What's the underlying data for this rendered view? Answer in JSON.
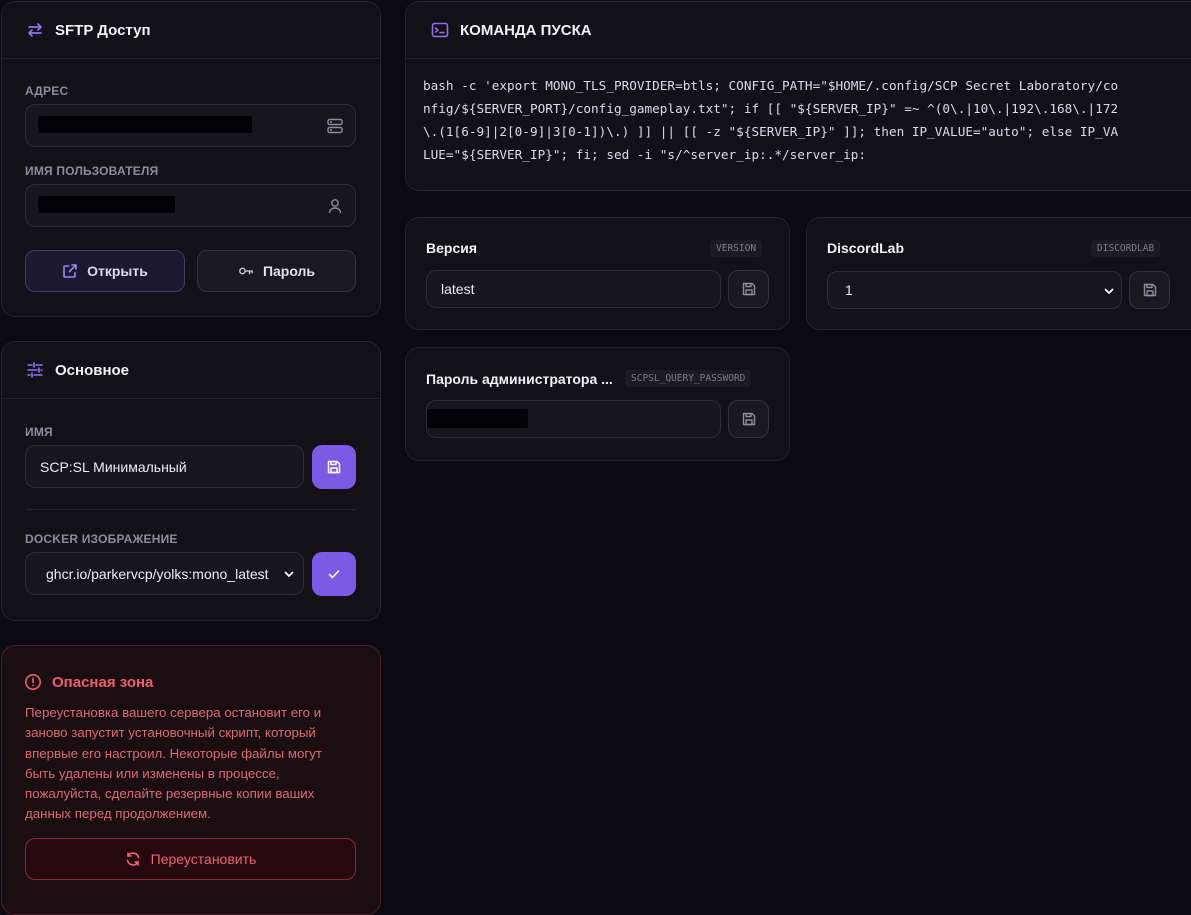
{
  "sftp": {
    "title": "SFTP Доступ",
    "address_label": "АДРЕС",
    "username_label": "ИМЯ ПОЛЬЗОВАТЕЛЯ",
    "open_button": "Открыть",
    "password_button": "Пароль"
  },
  "basic": {
    "title": "Основное",
    "name_label": "ИМЯ",
    "name_value": "SCP:SL Минимальный",
    "docker_label": "DOCKER ИЗОБРАЖЕНИЕ",
    "docker_value": "ghcr.io/parkervcp/yolks:mono_latest"
  },
  "danger": {
    "title": "Опасная зона",
    "text": "Переустановка вашего сервера остановит его и заново запустит установочный скрипт, который впервые его настроил. Некоторые файлы могут быть удалены или изменены в процессе, пожалуйста, сделайте резервные копии ваших данных перед продолжением.",
    "reinstall_button": "Переустановить"
  },
  "startup": {
    "title": "КОМАНДА ПУСКА",
    "command": "bash -c 'export MONO_TLS_PROVIDER=btls; CONFIG_PATH=\"$HOME/.config/SCP Secret Laboratory/config/${SERVER_PORT}/config_gameplay.txt\"; if [[ \"${SERVER_IP}\" =~ ^(0\\.|10\\.|192\\.168\\.|172\\.(1[6-9]|2[0-9]|3[0-1])\\.) ]] || [[ -z \"${SERVER_IP}\" ]]; then IP_VALUE=\"auto\"; else IP_VALUE=\"${SERVER_IP}\"; fi; sed -i \"s/^server_ip:.*/server_ip:"
  },
  "variables": {
    "version": {
      "title": "Версия",
      "tag": "VERSION",
      "value": "latest"
    },
    "discordlab": {
      "title": "DiscordLab",
      "tag": "DISCORDLAB",
      "value": "1"
    },
    "admin_password": {
      "title": "Пароль администратора ...",
      "tag": "SCPSL_QUERY_PASSWORD"
    }
  },
  "colors": {
    "accent": "#7b5be6",
    "danger": "#f25c69",
    "background": "#0c0b11",
    "card": "#121118"
  },
  "icons": [
    "swap-arrows-icon",
    "server-icon",
    "user-icon",
    "external-link-icon",
    "key-icon",
    "sliders-icon",
    "save-icon",
    "check-icon",
    "alert-circle-icon",
    "refresh-icon",
    "terminal-icon",
    "chevron-down-icon"
  ]
}
